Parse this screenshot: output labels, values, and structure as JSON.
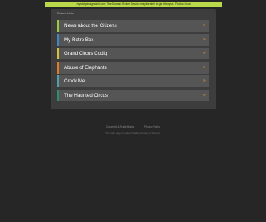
{
  "banner": {
    "text": "mystickyimagesimil.com: The Domain Broker Service may be able to get it for you. Find out how.",
    "bg_color": "#b9d84a"
  },
  "panel": {
    "title": "Related Links",
    "links": [
      {
        "label": "News about the Citizens",
        "arrow": "»",
        "color": "#9ccc3c"
      },
      {
        "label": "My Retro Box",
        "arrow": "»",
        "color": "#3f86c8"
      },
      {
        "label": "Grand Circus Codiq",
        "arrow": "»",
        "color": "#d6c23a"
      },
      {
        "label": "Abuse of Elephants",
        "arrow": "»",
        "color": "#e07b22"
      },
      {
        "label": "Crock Me",
        "arrow": "»",
        "color": "#4fa0a8"
      },
      {
        "label": "The Haunted Circus",
        "arrow": "»",
        "color": "#2e8f6a"
      }
    ]
  },
  "footer": {
    "links": [
      "Copyright & Trade Marks",
      "Privacy Policy"
    ],
    "note": "This web page is parked FREE, courtesy of Domain."
  }
}
